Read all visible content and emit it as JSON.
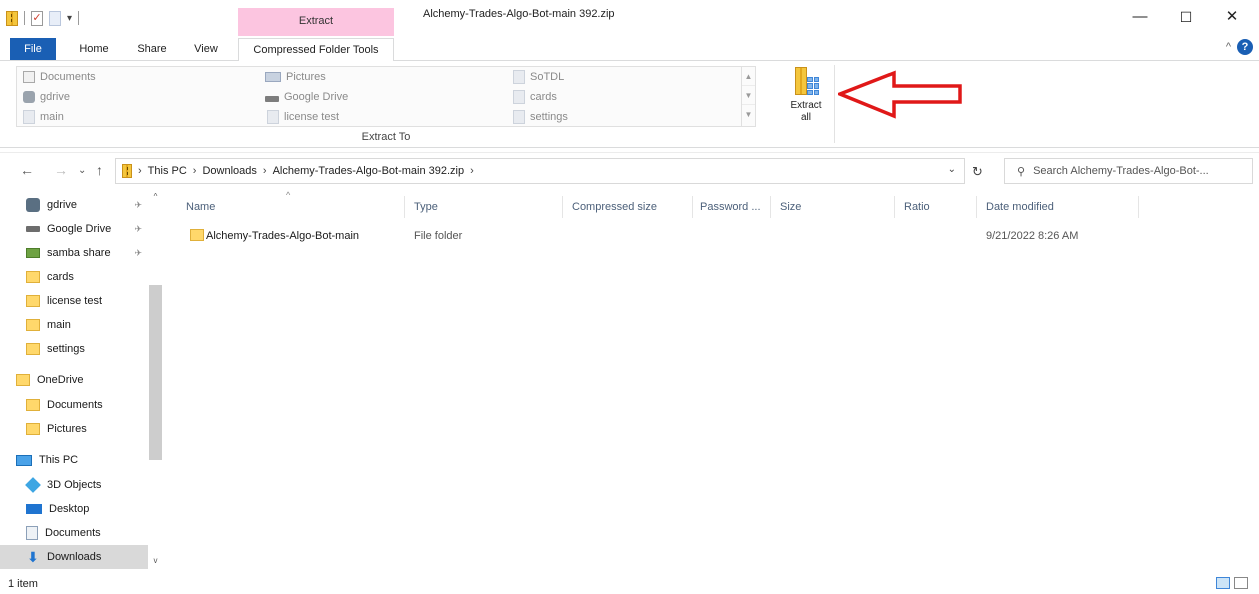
{
  "window": {
    "title": "Alchemy-Trades-Algo-Bot-main 392.zip",
    "contextual_tab_group": "Extract",
    "controls": {
      "minimize": "—",
      "maximize": "☐",
      "close": "✕"
    }
  },
  "ribbon_tabs": {
    "file": "File",
    "home": "Home",
    "share": "Share",
    "view": "View",
    "compressed_folder_tools": "Compressed Folder Tools",
    "help": "?"
  },
  "ribbon": {
    "extract_to_items": [
      {
        "label": "Documents",
        "icon": "documents-icon"
      },
      {
        "label": "gdrive",
        "icon": "gdrive-icon"
      },
      {
        "label": "main",
        "icon": "file-icon"
      },
      {
        "label": "Pictures",
        "icon": "pictures-icon"
      },
      {
        "label": "Google Drive",
        "icon": "drive-icon"
      },
      {
        "label": "license test",
        "icon": "file-icon"
      },
      {
        "label": "SoTDL",
        "icon": "file-icon"
      },
      {
        "label": "cards",
        "icon": "file-icon"
      },
      {
        "label": "settings",
        "icon": "file-icon"
      }
    ],
    "group_label": "Extract To",
    "extract_all_line1": "Extract",
    "extract_all_line2": "all",
    "annotation_color": "#e01818"
  },
  "address": {
    "crumbs": [
      "This PC",
      "Downloads",
      "Alchemy-Trades-Algo-Bot-main 392.zip"
    ],
    "search_placeholder": "Search Alchemy-Trades-Algo-Bot-..."
  },
  "nav_pane": {
    "items": [
      {
        "label": "gdrive",
        "icon": "gdrive-icon",
        "pinned": true
      },
      {
        "label": "Google Drive",
        "icon": "drive-icon",
        "pinned": true
      },
      {
        "label": "samba share",
        "icon": "network-drive-icon",
        "pinned": true
      },
      {
        "label": "cards",
        "icon": "folder-icon"
      },
      {
        "label": "license test",
        "icon": "folder-icon"
      },
      {
        "label": "main",
        "icon": "folder-icon"
      },
      {
        "label": "settings",
        "icon": "folder-icon"
      },
      {
        "label": "OneDrive",
        "icon": "folder-icon"
      },
      {
        "label": "Documents",
        "icon": "folder-icon"
      },
      {
        "label": "Pictures",
        "icon": "folder-icon"
      },
      {
        "label": "This PC",
        "icon": "pc-icon"
      },
      {
        "label": "3D Objects",
        "icon": "cube-icon"
      },
      {
        "label": "Desktop",
        "icon": "desktop-icon"
      },
      {
        "label": "Documents",
        "icon": "documents-icon"
      },
      {
        "label": "Downloads",
        "icon": "download-icon",
        "selected": true
      }
    ]
  },
  "file_list": {
    "columns": [
      "Name",
      "Type",
      "Compressed size",
      "Password ...",
      "Size",
      "Ratio",
      "Date modified"
    ],
    "rows": [
      {
        "name": "Alchemy-Trades-Algo-Bot-main",
        "type": "File folder",
        "compressed_size": "",
        "password": "",
        "size": "",
        "ratio": "",
        "date_modified": "9/21/2022 8:26 AM"
      }
    ]
  },
  "status": {
    "item_count": "1 item"
  },
  "colors": {
    "file_tab": "#1a5fb4",
    "context_tab": "#fcc5e0",
    "selection": "#cce4f7",
    "folder": "#ffd86b"
  }
}
